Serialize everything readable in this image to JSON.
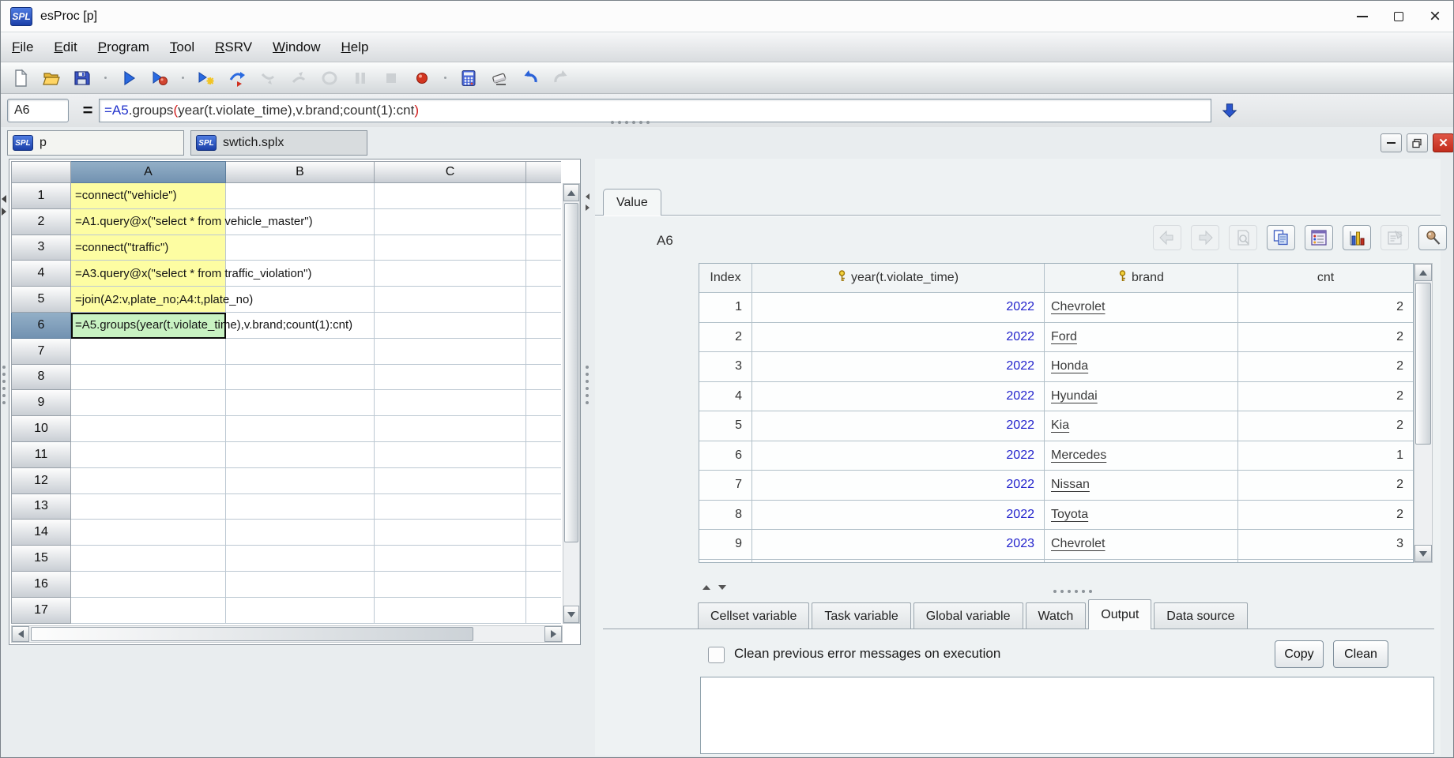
{
  "window": {
    "title": "esProc [p]",
    "logo_text": "SPL",
    "controls": [
      "minimize",
      "maximize",
      "close"
    ]
  },
  "menu": [
    "File",
    "Edit",
    "Program",
    "Tool",
    "RSRV",
    "Window",
    "Help"
  ],
  "toolbar": {
    "icons": [
      "new-file",
      "open-file",
      "save",
      "execute",
      "execute-debug",
      "calc-current-cell",
      "step-next",
      "step-into-disabled",
      "step-return-disabled",
      "calc-locked-disabled",
      "pause-disabled",
      "stop-disabled",
      "breakpoint",
      "calculator",
      "clear-cells",
      "undo",
      "redo-disabled"
    ]
  },
  "formula_bar": {
    "cell_ref": "A6",
    "equals": "=",
    "formula_parts": [
      {
        "text": "=A5",
        "color": "blue"
      },
      {
        "text": ".groups",
        "color": "dark"
      },
      {
        "text": "(",
        "color": "red"
      },
      {
        "text": "year(t.violate_time),v.brand;count(1):cnt",
        "color": "dark"
      },
      {
        "text": ")",
        "color": "red"
      }
    ]
  },
  "file_tabs": [
    {
      "label": "p",
      "active": true
    },
    {
      "label": "swtich.splx",
      "active": false
    }
  ],
  "frame_controls": [
    "minimize",
    "restore",
    "close"
  ],
  "grid": {
    "column_headers": [
      "A",
      "B",
      "C"
    ],
    "selected_column": "A",
    "selected_row": 6,
    "row_count": 17,
    "cells": [
      {
        "cell": "A1",
        "code": "=connect(\"vehicle\")"
      },
      {
        "cell": "A2",
        "code": "=A1.query@x(\"select * from vehicle_master\")"
      },
      {
        "cell": "A3",
        "code": "=connect(\"traffic\")"
      },
      {
        "cell": "A4",
        "code": "=A3.query@x(\"select * from traffic_violation\")"
      },
      {
        "cell": "A5",
        "code": "=join(A2:v,plate_no;A4:t,plate_no)"
      },
      {
        "cell": "A6",
        "code": "=A5.groups(year(t.violate_time),v.brand;count(1):cnt)"
      }
    ]
  },
  "value_panel": {
    "tab_label": "Value",
    "cell_label": "A6",
    "icons": [
      "back",
      "forward",
      "preview",
      "copy",
      "detail-list",
      "draw-chart",
      "edit",
      "pin"
    ],
    "table": {
      "columns": [
        {
          "label": "Index",
          "key": false
        },
        {
          "label": "year(t.violate_time)",
          "key": true
        },
        {
          "label": "brand",
          "key": true
        },
        {
          "label": "cnt",
          "key": false
        }
      ],
      "rows": [
        [
          1,
          2022,
          "Chevrolet",
          2
        ],
        [
          2,
          2022,
          "Ford",
          2
        ],
        [
          3,
          2022,
          "Honda",
          2
        ],
        [
          4,
          2022,
          "Hyundai",
          2
        ],
        [
          5,
          2022,
          "Kia",
          2
        ],
        [
          6,
          2022,
          "Mercedes",
          1
        ],
        [
          7,
          2022,
          "Nissan",
          2
        ],
        [
          8,
          2022,
          "Toyota",
          2
        ],
        [
          9,
          2023,
          "Chevrolet",
          3
        ]
      ]
    }
  },
  "bottom_tabs": [
    {
      "label": "Cellset variable",
      "selected": false
    },
    {
      "label": "Task variable",
      "selected": false
    },
    {
      "label": "Global variable",
      "selected": false
    },
    {
      "label": "Watch",
      "selected": false
    },
    {
      "label": "Output",
      "selected": true
    },
    {
      "label": "Data source",
      "selected": false
    }
  ],
  "output_panel": {
    "checkbox_label": "Clean previous error messages on execution",
    "checkbox_checked": false,
    "copy_label": "Copy",
    "clean_label": "Clean",
    "console_text": ""
  },
  "colors": {
    "accent_blue": "#2233cc",
    "cell_yellow": "#fdfda2",
    "cell_green": "#c8f2c2",
    "selected_header_blue": "#7e9cba",
    "year_text_blue": "#2222cc",
    "close_red": "#c22d1d"
  }
}
